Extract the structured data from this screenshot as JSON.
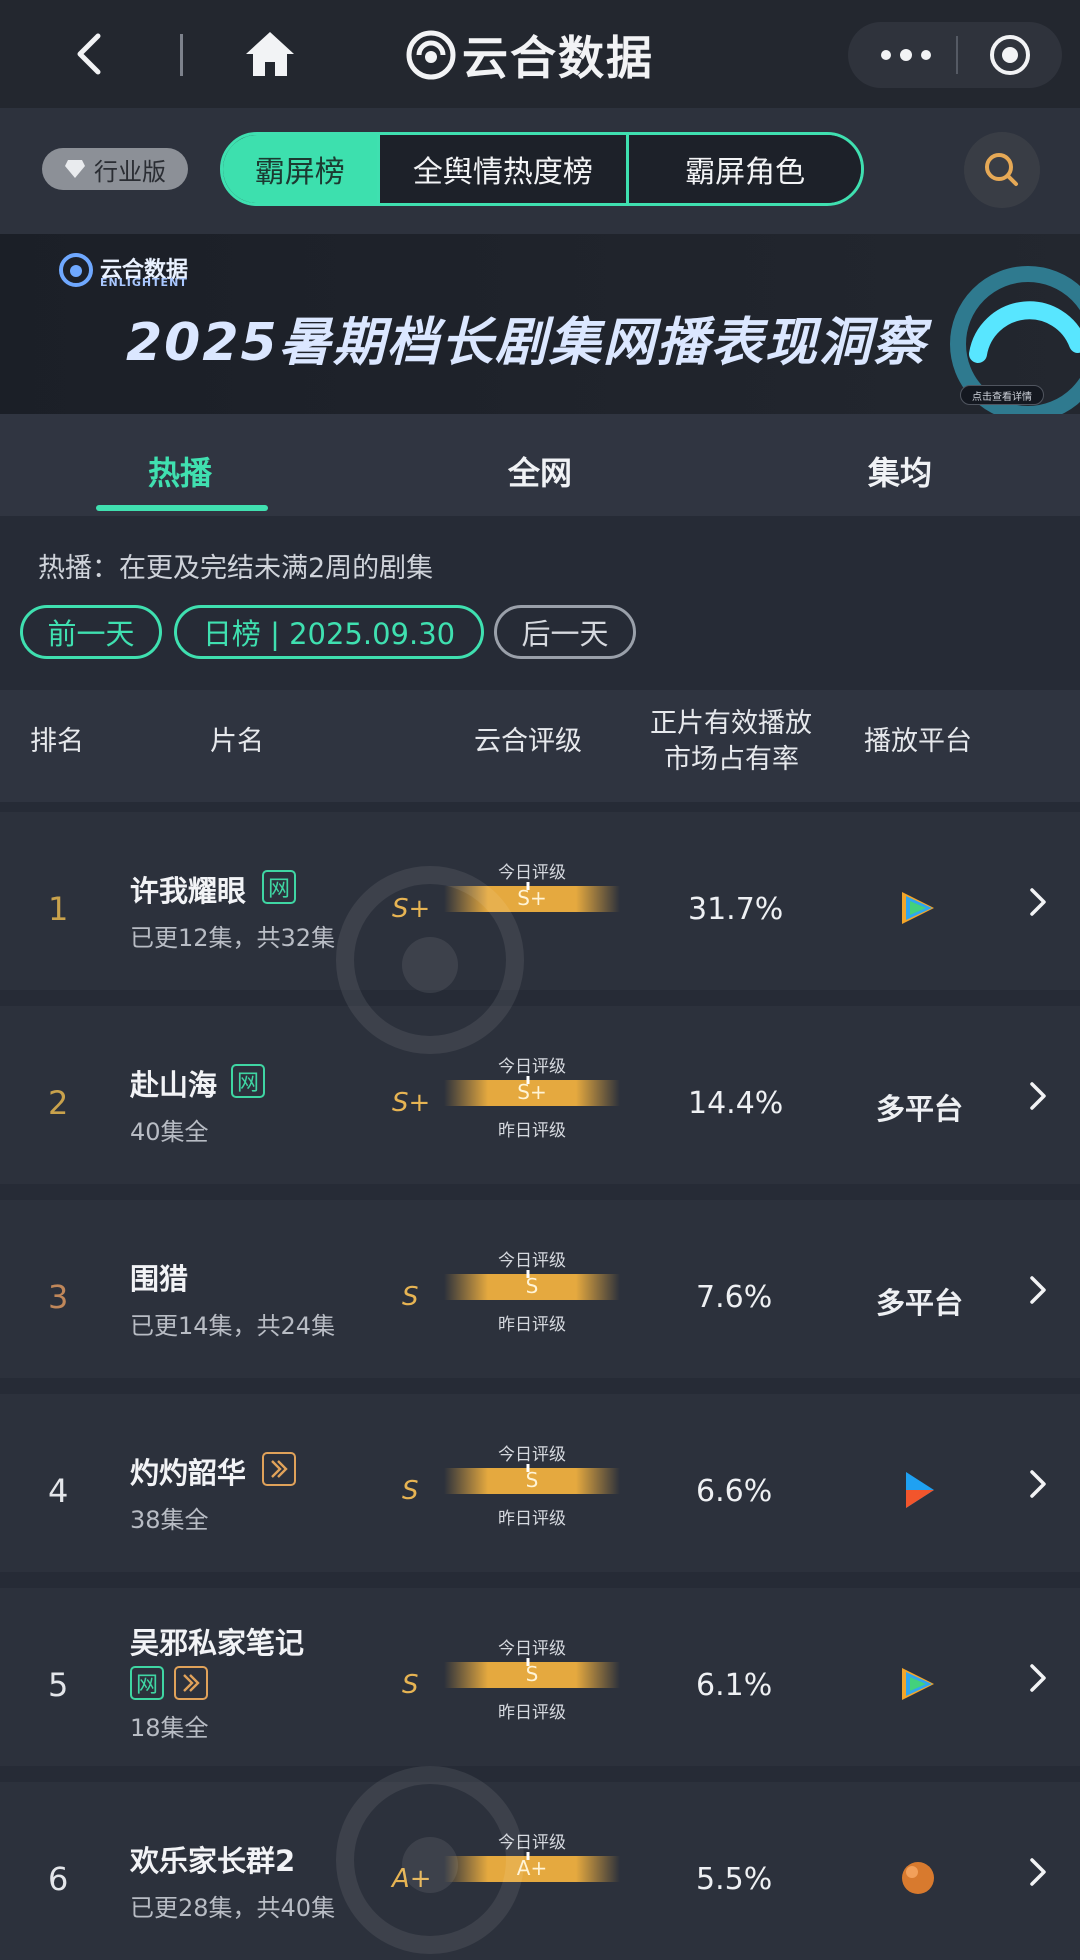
{
  "app": {
    "title": "云合数据"
  },
  "toolbar": {
    "edition_label": "行业版",
    "segments": [
      "霸屏榜",
      "全舆情热度榜",
      "霸屏角色"
    ],
    "active_segment": 0
  },
  "banner": {
    "brand": "云合数据",
    "brand_en": "ENLIGHTENT",
    "title": "2025暑期档长剧集网播表现洞察",
    "tip": "点击查看详情"
  },
  "tabs": {
    "items": [
      "热播",
      "全网",
      "集均"
    ],
    "active": 0
  },
  "description": "热播：在更及完结未满2周的剧集",
  "date_nav": {
    "prev": "前一天",
    "current": "日榜 | 2025.09.30",
    "next": "后一天"
  },
  "table": {
    "headers": {
      "rank": "排名",
      "title": "片名",
      "rating": "云合评级",
      "share_line1": "正片有效播放",
      "share_line2": "市场占有率",
      "platform": "播放平台"
    },
    "gauge_labels": {
      "today": "今日评级",
      "yesterday": "昨日评级"
    },
    "rows": [
      {
        "rank": "1",
        "title": "许我耀眼",
        "tags": [
          "网"
        ],
        "sub": "已更12集，共32集",
        "grade": "S+",
        "today": "S+",
        "yesterday": "",
        "share": "31.7%",
        "platform": "",
        "platform_icon": "tencent-video-icon"
      },
      {
        "rank": "2",
        "title": "赴山海",
        "tags": [
          "网"
        ],
        "sub": "40集全",
        "grade": "S+",
        "today": "S+",
        "yesterday": "昨日评级",
        "share": "14.4%",
        "platform": "多平台",
        "platform_icon": ""
      },
      {
        "rank": "3",
        "title": "围猎",
        "tags": [],
        "sub": "已更14集，共24集",
        "grade": "S",
        "today": "S",
        "yesterday": "昨日评级",
        "share": "7.6%",
        "platform": "多平台",
        "platform_icon": ""
      },
      {
        "rank": "4",
        "title": "灼灼韶华",
        "tags": [
          "play"
        ],
        "sub": "38集全",
        "grade": "S",
        "today": "S",
        "yesterday": "昨日评级",
        "share": "6.6%",
        "platform": "",
        "platform_icon": "youku-icon"
      },
      {
        "rank": "5",
        "title": "吴邪私家笔记",
        "tags": [
          "网",
          "play"
        ],
        "sub": "18集全",
        "grade": "S",
        "today": "S",
        "yesterday": "昨日评级",
        "share": "6.1%",
        "platform": "",
        "platform_icon": "tencent-video-icon"
      },
      {
        "rank": "6",
        "title": "欢乐家长群2",
        "tags": [],
        "sub": "已更28集，共40集",
        "grade": "A+",
        "today": "A+",
        "yesterday": "",
        "share": "5.5%",
        "platform": "",
        "platform_icon": "mango-tv-icon"
      }
    ]
  },
  "colors": {
    "accent": "#3fe0b0",
    "gold": "#e7b453",
    "bg": "#262b36"
  }
}
